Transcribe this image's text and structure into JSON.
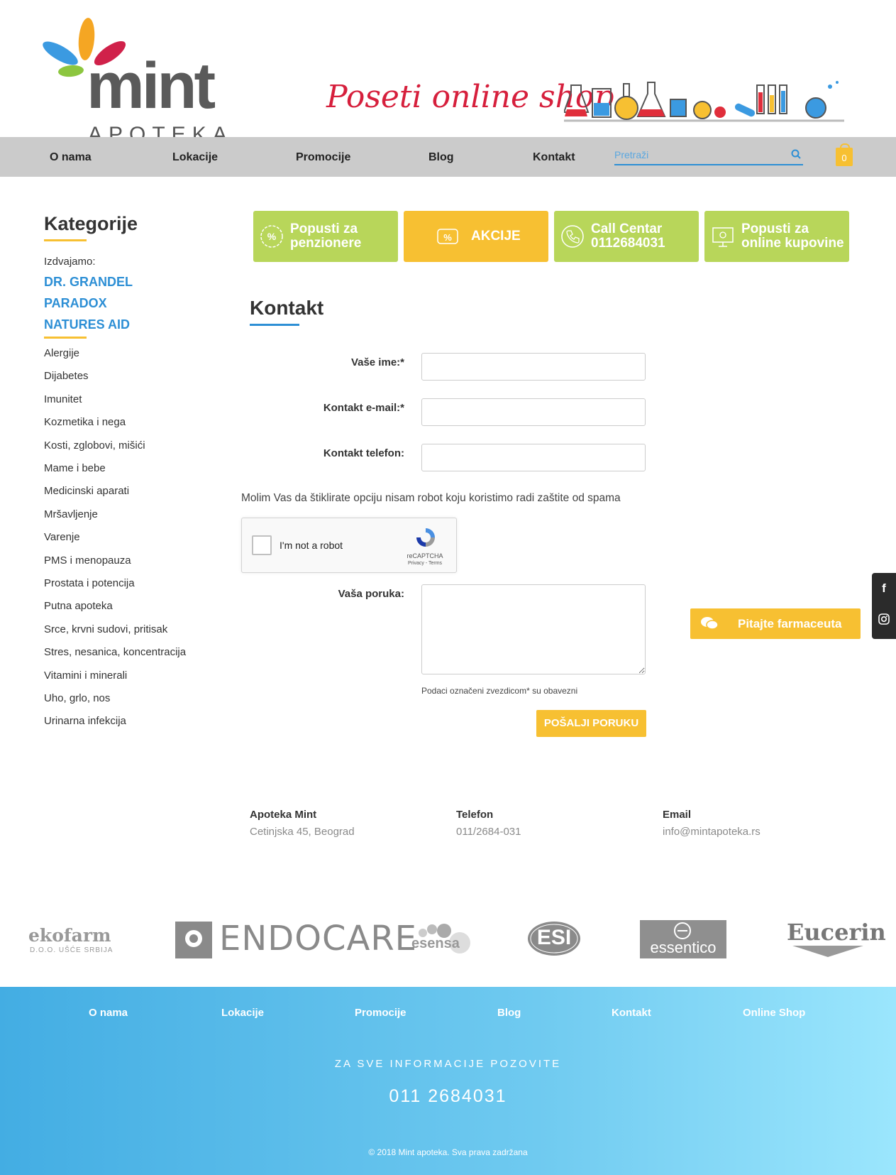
{
  "header": {
    "logo_word": "mint",
    "logo_sub": "APOTEKA",
    "promo_text": "Poseti online shop"
  },
  "nav": {
    "items": [
      "O nama",
      "Lokacije",
      "Promocije",
      "Blog",
      "Kontakt"
    ],
    "search_placeholder": "Pretraži",
    "cart_count": "0"
  },
  "sidebar": {
    "title": "Kategorije",
    "featured_label": "Izdvajamo:",
    "featured": [
      "DR. GRANDEL",
      "PARADOX",
      "NATURES AID"
    ],
    "categories": [
      "Alergije",
      "Dijabetes",
      "Imunitet",
      "Kozmetika i nega",
      "Kosti, zglobovi, mišići",
      "Mame i bebe",
      "Medicinski aparati",
      "Mršavljenje",
      "Varenje",
      "PMS i menopauza",
      "Prostata i potencija",
      "Putna apoteka",
      "Srce, krvni sudovi, pritisak",
      "Stres, nesanica, koncentracija",
      "Vitamini i minerali",
      "Uho, grlo, nos",
      "Urinarna infekcija"
    ]
  },
  "boxes": [
    {
      "line1": "Popusti za",
      "line2": "penzionere"
    },
    {
      "line1": "AKCIJE",
      "line2": ""
    },
    {
      "line1": "Call Centar",
      "line2": "0112684031"
    },
    {
      "line1": "Popusti za",
      "line2": "online kupovine"
    }
  ],
  "form": {
    "title": "Kontakt",
    "name_label": "Vaše ime:*",
    "email_label": "Kontakt e-mail:*",
    "phone_label": "Kontakt telefon:",
    "captcha_note": "Molim Vas da štiklirate opciju nisam robot koju koristimo radi zaštite od spama",
    "captcha_text": "I'm not a robot",
    "captcha_brand": "reCAPTCHA",
    "captcha_links": "Privacy - Terms",
    "message_label": "Vaša poruka:",
    "required_note": "Podaci označeni zvezdicom* su obavezni",
    "submit": "POŠALJI PORUKU"
  },
  "info": [
    {
      "title": "Apoteka Mint",
      "value": "Cetinjska 45, Beograd"
    },
    {
      "title": "Telefon",
      "value": "011/2684-031"
    },
    {
      "title": "Email",
      "value": "info@mintapoteka.rs"
    }
  ],
  "ask_button": "Pitajte farmaceuta",
  "brands": [
    "ekofarm",
    "D.O.O. UŠĆE SRBIJA",
    "ENDOCARE",
    "esensa",
    "ESI",
    "essentico",
    "Eucerin"
  ],
  "footer": {
    "links": [
      "O nama",
      "Lokacije",
      "Promocije",
      "Blog",
      "Kontakt",
      "Online Shop"
    ],
    "call_label": "ZA SVE INFORMACIJE POZOVITE",
    "phone": "011 2684031",
    "copyright": "© 2018 Mint apoteka. Sva prava zadržana"
  },
  "colors": {
    "accent_blue": "#2d8fd5",
    "yellow": "#f7c032",
    "green": "#b8d65a"
  }
}
